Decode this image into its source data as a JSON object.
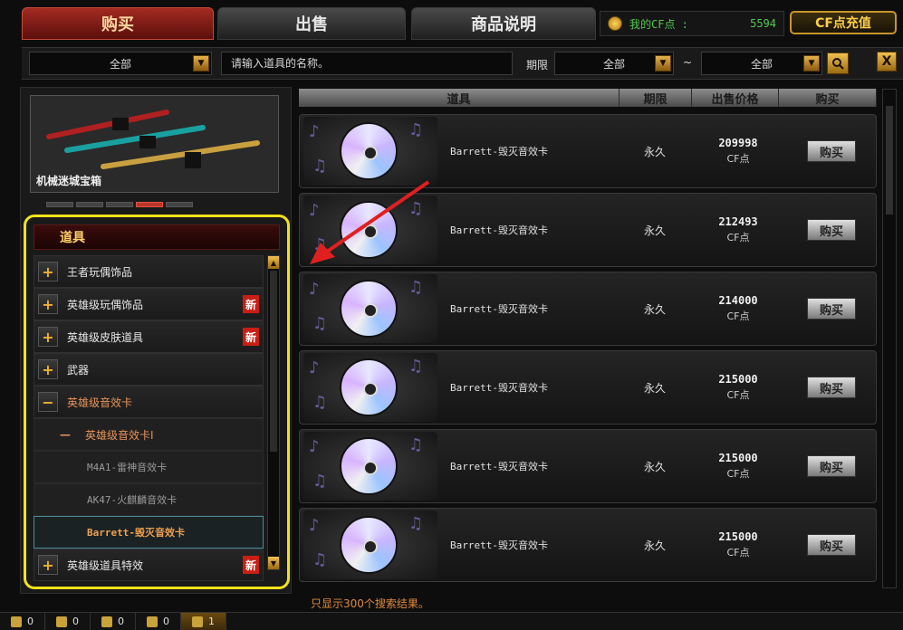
{
  "tabs": [
    {
      "label": "购买"
    },
    {
      "label": "出售"
    },
    {
      "label": "商品说明"
    }
  ],
  "account": {
    "cf_label": "我的CF点 :",
    "cf_value": "5594",
    "recharge_label": "CF点充值"
  },
  "filters": {
    "category_select": "全部",
    "search_placeholder": "请输入道具的名称。",
    "period_label": "期限",
    "period_from": "全部",
    "tilde": "~",
    "period_to": "全部",
    "close_label": "X"
  },
  "featured": {
    "title": "机械迷城宝箱"
  },
  "category_panel": {
    "header": "道具",
    "items": [
      {
        "label": "王者玩偶饰品",
        "new": ""
      },
      {
        "label": "英雄级玩偶饰品",
        "new": "新"
      },
      {
        "label": "英雄级皮肤道具",
        "new": "新"
      },
      {
        "label": "武器",
        "new": ""
      },
      {
        "label": "英雄级音效卡",
        "new": ""
      }
    ],
    "sub_group": "英雄级音效卡I",
    "sub_items": [
      {
        "label": "M4A1-雷神音效卡"
      },
      {
        "label": "AK47-火麒麟音效卡"
      },
      {
        "label": "Barrett-毁灭音效卡"
      }
    ],
    "last_item": {
      "label": "英雄级道具特效",
      "new": "新"
    }
  },
  "table": {
    "columns": [
      "道具",
      "期限",
      "出售价格",
      "购买"
    ],
    "rows": [
      {
        "name": "Barrett-毁灭音效卡",
        "period": "永久",
        "price": "209998",
        "unit": "CF点",
        "buy": "购买"
      },
      {
        "name": "Barrett-毁灭音效卡",
        "period": "永久",
        "price": "212493",
        "unit": "CF点",
        "buy": "购买"
      },
      {
        "name": "Barrett-毁灭音效卡",
        "period": "永久",
        "price": "214000",
        "unit": "CF点",
        "buy": "购买"
      },
      {
        "name": "Barrett-毁灭音效卡",
        "period": "永久",
        "price": "215000",
        "unit": "CF点",
        "buy": "购买"
      },
      {
        "name": "Barrett-毁灭音效卡",
        "period": "永久",
        "price": "215000",
        "unit": "CF点",
        "buy": "购买"
      },
      {
        "name": "Barrett-毁灭音效卡",
        "period": "永久",
        "price": "215000",
        "unit": "CF点",
        "buy": "购买"
      }
    ]
  },
  "result_note": "只显示300个搜索结果。",
  "bottombar": [
    {
      "icon": "list-icon",
      "count": "0"
    },
    {
      "icon": "person-icon",
      "count": "0"
    },
    {
      "icon": "clan-icon",
      "count": "0"
    },
    {
      "icon": "chat-icon",
      "count": "0"
    },
    {
      "icon": "speaker-icon",
      "count": "1"
    }
  ]
}
